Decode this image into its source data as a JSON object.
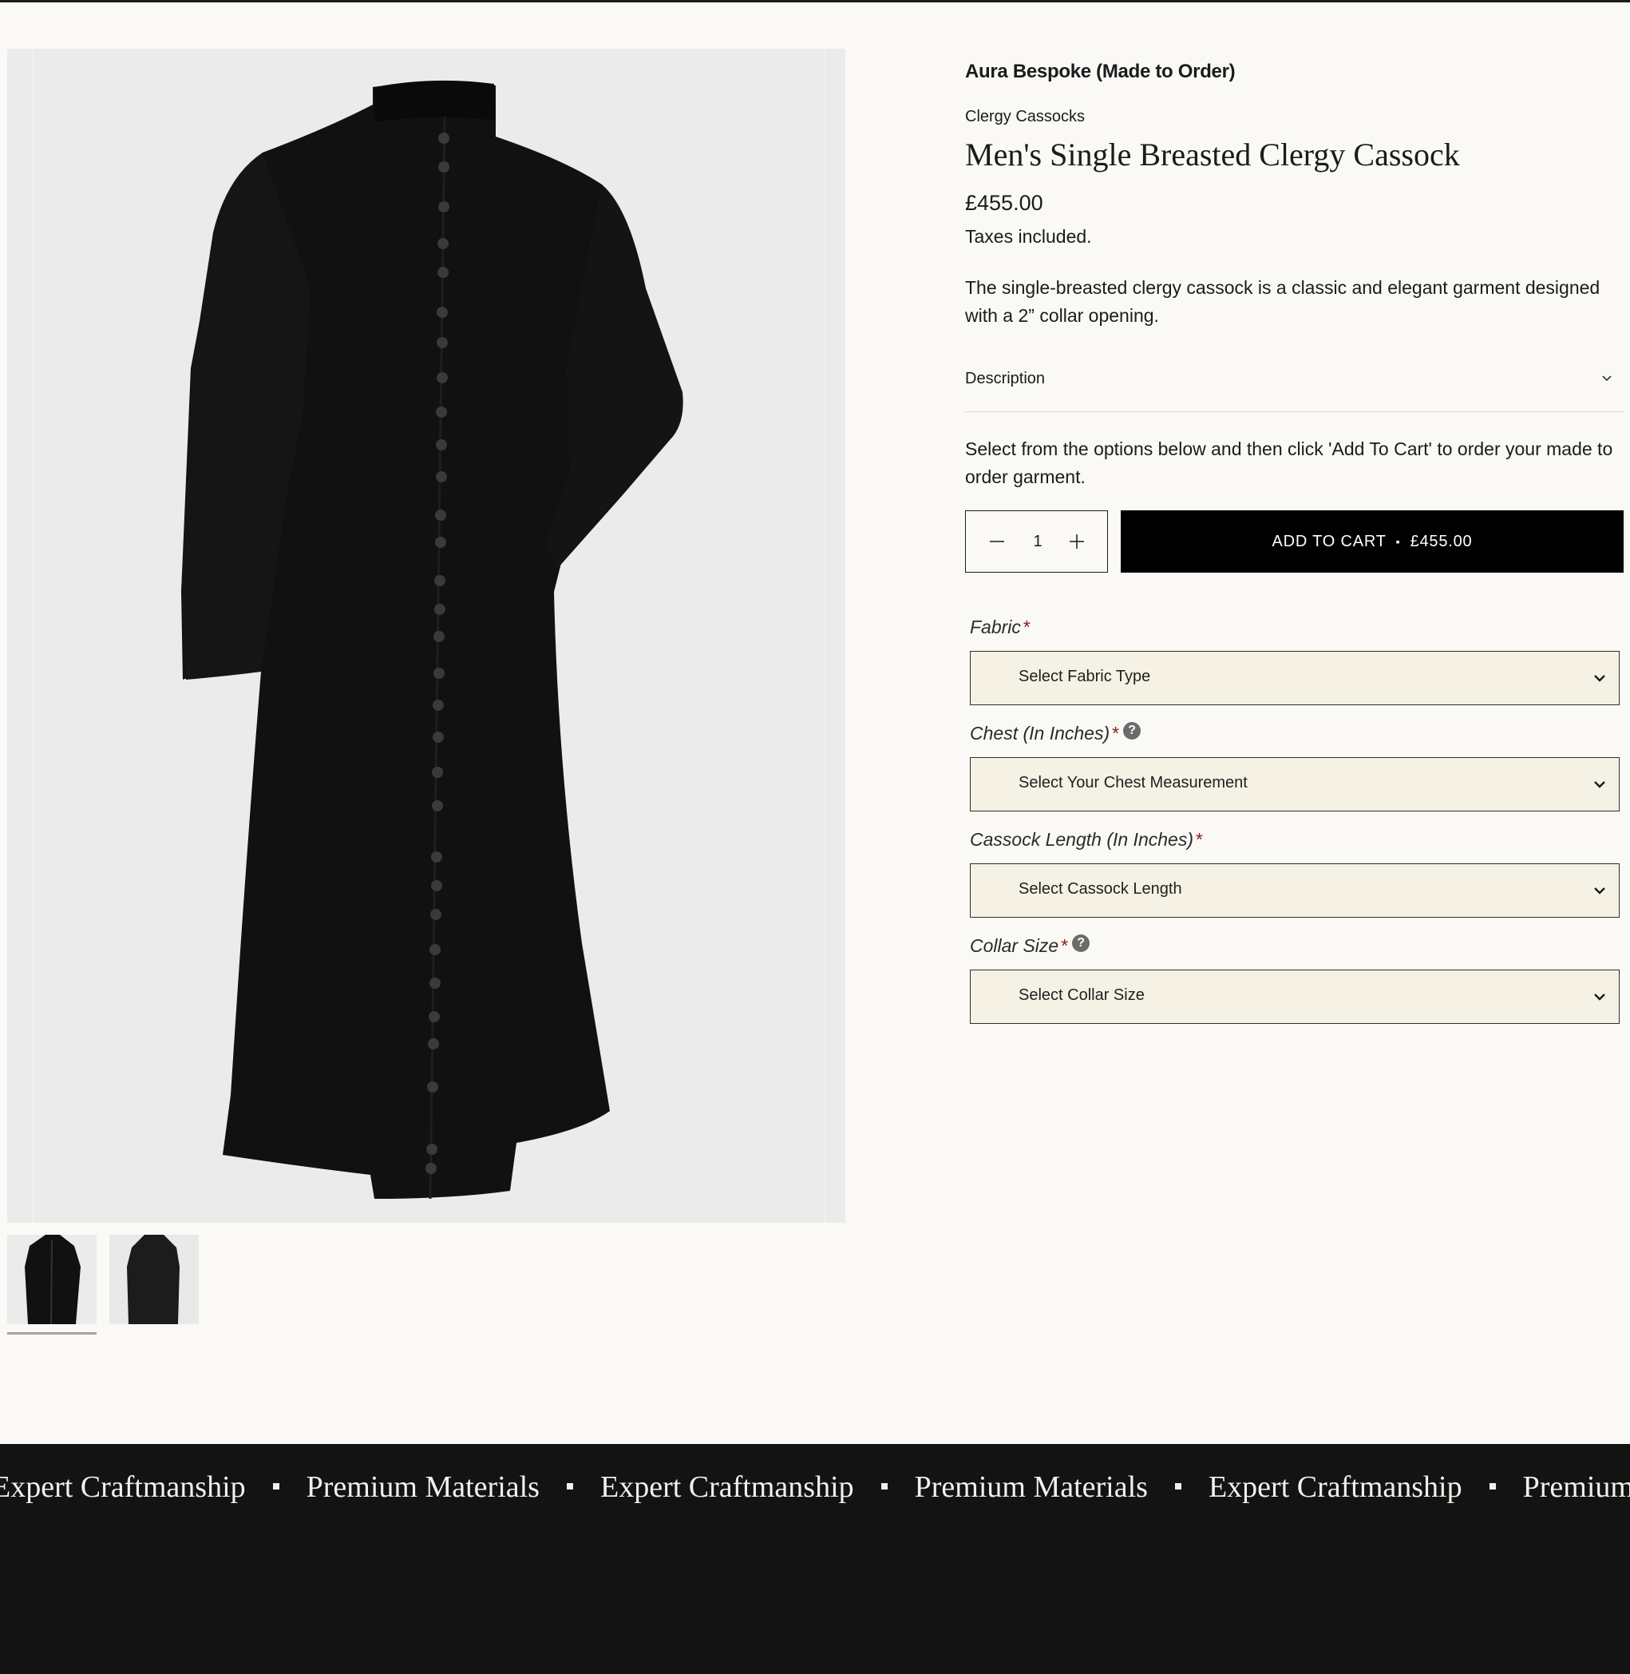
{
  "product": {
    "vendor": "Aura Bespoke (Made to Order)",
    "collection": "Clergy Cassocks",
    "title": "Men's Single Breasted Clergy Cassock",
    "price": "£455.00",
    "tax_note": "Taxes included.",
    "blurb": "The single-breasted clergy cassock is a classic and elegant garment designed with a 2” collar opening."
  },
  "accordion": {
    "label": "Description",
    "icon": "chevron-down-icon"
  },
  "instructions": "Select from the options below and then click 'Add To Cart' to order your made to order garment.",
  "quantity": {
    "value": "1",
    "minus_icon": "minus-icon",
    "plus_icon": "plus-icon"
  },
  "cart": {
    "label": "ADD TO CART",
    "separator": "▪",
    "price": "£455.00"
  },
  "options": [
    {
      "label": "Fabric",
      "required": "*",
      "help": false,
      "placeholder": "Select Fabric Type"
    },
    {
      "label": "Chest (In Inches)",
      "required": "*",
      "help": true,
      "help_glyph": "?",
      "placeholder": "Select Your Chest Measurement"
    },
    {
      "label": "Cassock Length (In Inches)",
      "required": "*",
      "help": false,
      "placeholder": "Select Cassock Length"
    },
    {
      "label": "Collar Size",
      "required": "*",
      "help": true,
      "help_glyph": "?",
      "placeholder": "Select Collar Size"
    }
  ],
  "marquee": {
    "items": [
      "Expert Craftmanship",
      "Premium Materials",
      "Expert Craftmanship",
      "Premium Materials",
      "Expert Craftmanship",
      "Premium"
    ]
  },
  "colors": {
    "background": "#faf9f6",
    "select_bg": "#f5f1e4",
    "required": "#8b1c12",
    "banner": "#131313",
    "button": "#000000"
  }
}
